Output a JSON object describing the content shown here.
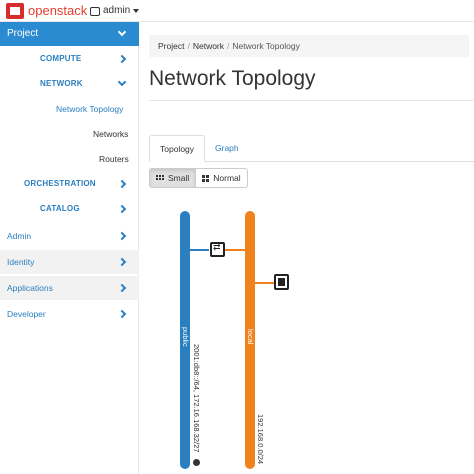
{
  "header": {
    "brand": "openstack",
    "user_menu": "admin"
  },
  "sidebar": {
    "project_label": "Project",
    "compute_label": "COMPUTE",
    "network_label": "NETWORK",
    "network_items": [
      {
        "label": "Network Topology",
        "active": true
      },
      {
        "label": "Networks",
        "active": false
      },
      {
        "label": "Routers",
        "active": false
      }
    ],
    "orchestration_label": "ORCHESTRATION",
    "catalog_label": "CATALOG",
    "sections": [
      {
        "label": "Admin"
      },
      {
        "label": "Identity"
      },
      {
        "label": "Applications"
      },
      {
        "label": "Developer"
      }
    ]
  },
  "breadcrumb": {
    "items": [
      "Project",
      "Network",
      "Network Topology"
    ]
  },
  "page_title": "Network Topology",
  "tabs": [
    {
      "label": "Topology",
      "active": true
    },
    {
      "label": "Graph",
      "active": false
    }
  ],
  "view_toggle": {
    "small_label": "Small",
    "normal_label": "Normal",
    "selected": "Small"
  },
  "topology": {
    "networks": [
      {
        "name": "public",
        "cidr": "2001:db8::/64, 172.16.168.32/27",
        "color": "#2a7fc0"
      },
      {
        "name": "local",
        "cidr": "192.168.0.0/24",
        "color": "#f0821e"
      }
    ],
    "devices": [
      {
        "type": "router",
        "icon": "router-icon"
      },
      {
        "type": "instance",
        "icon": "instance-icon"
      }
    ]
  },
  "colors": {
    "accent": "#2a8bd0",
    "brand": "#e53d30"
  }
}
